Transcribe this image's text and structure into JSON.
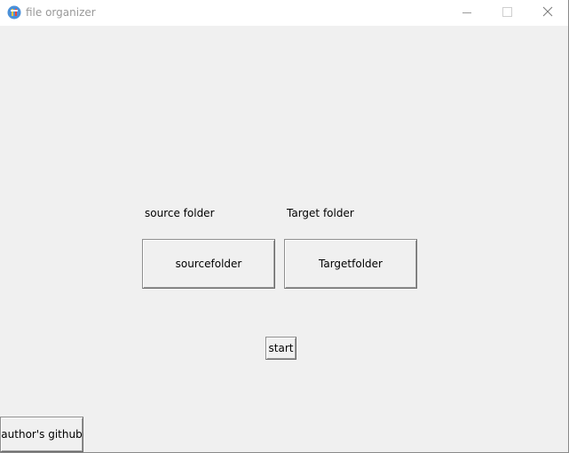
{
  "window": {
    "title": "file organizer",
    "icon": "python-feather-icon",
    "controls": {
      "minimize_icon": "minimize-icon",
      "maximize_icon": "maximize-icon",
      "close_icon": "close-icon"
    }
  },
  "form": {
    "source_label": "source folder",
    "target_label": "Target folder",
    "source_button": "sourcefolder",
    "target_button": "Targetfolder",
    "start_button": "start",
    "github_button": "author's github"
  },
  "colors": {
    "background": "#f0f0f0",
    "titlebar": "#ffffff",
    "title_text": "#999999"
  }
}
